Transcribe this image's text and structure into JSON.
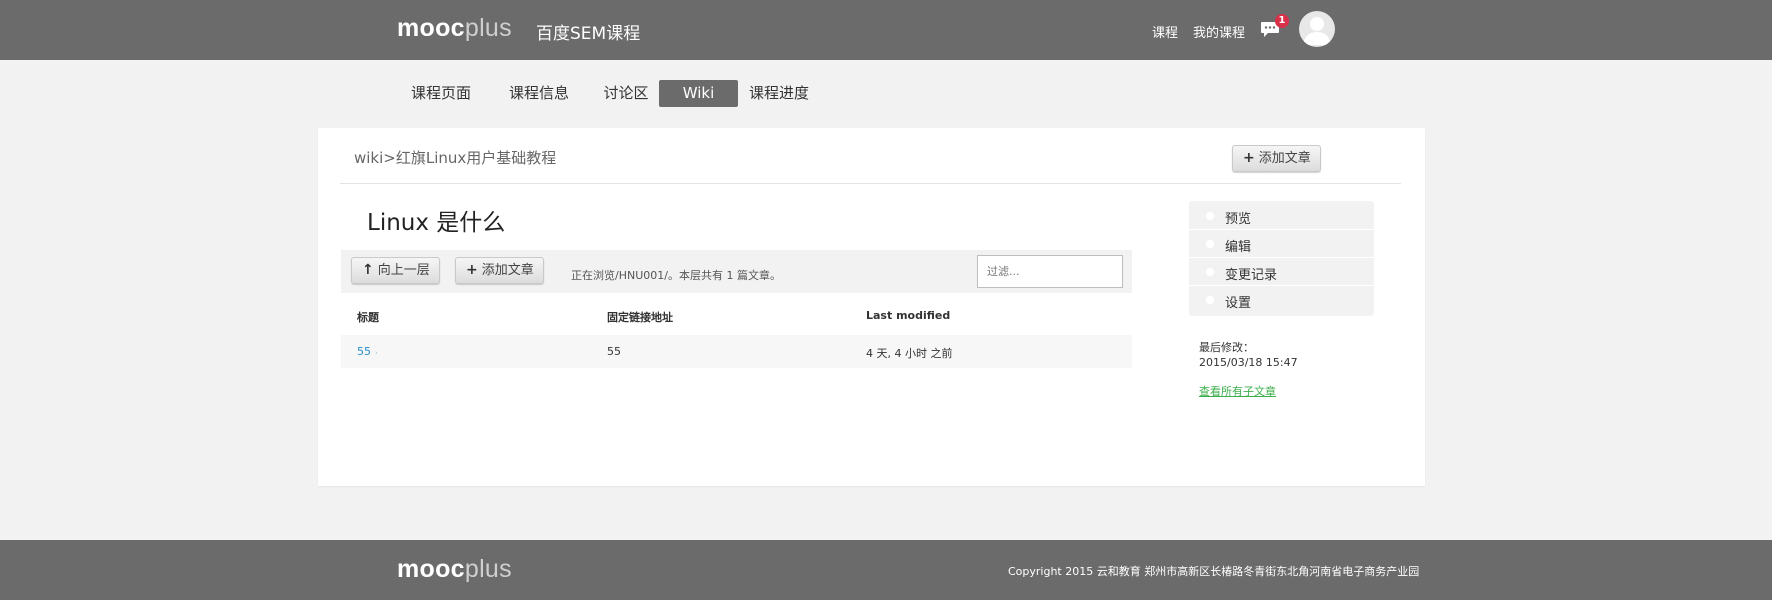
{
  "header": {
    "logo_primary": "mooc",
    "logo_secondary": "plus",
    "course_title": "百度SEM课程",
    "nav": [
      "课程",
      "我的课程"
    ],
    "message_count": "1"
  },
  "tabs": [
    {
      "label": "课程页面",
      "active": false
    },
    {
      "label": "课程信息",
      "active": false
    },
    {
      "label": "讨论区",
      "active": false
    },
    {
      "label": "Wiki",
      "active": true
    },
    {
      "label": "课程进度",
      "active": false
    }
  ],
  "breadcrumb": "wiki>红旗Linux用户基础教程",
  "add_article_label": "添加文章",
  "article": {
    "title": "Linux 是什么",
    "toolbar": {
      "up_label": "向上一层",
      "add_label": "添加文章",
      "info": "正在浏览/HNU001/。本层共有 1 篇文章。",
      "filter_placeholder": "过滤..."
    },
    "table": {
      "headers": [
        "标题",
        "固定链接地址",
        "Last modified"
      ],
      "rows": [
        {
          "title": "55",
          "slug": "55",
          "modified": "4 天, 4 小时 之前"
        }
      ]
    }
  },
  "sidebar": {
    "items": [
      "预览",
      "编辑",
      "变更记录",
      "设置"
    ],
    "last_modified_label": "最后修改：",
    "last_modified_value": "2015/03/18 15:47",
    "children_link": "查看所有子文章"
  },
  "footer": {
    "logo_primary": "mooc",
    "logo_secondary": "plus",
    "copyright": "Copyright 2015 云和教育 郑州市高新区长椿路冬青街东北角河南省电子商务产业园"
  },
  "colors": {
    "bar_gray": "#6b6b6b",
    "link_blue": "#2a8fc9",
    "link_green": "#3cae4b",
    "badge_red": "#d9304a"
  }
}
